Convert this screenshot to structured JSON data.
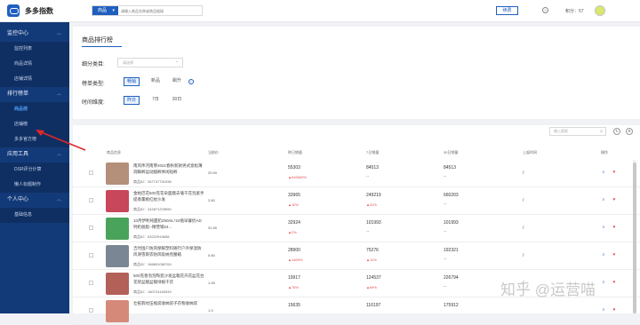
{
  "app": {
    "brand": "多多指数"
  },
  "search": {
    "select_label": "商品",
    "placeholder": "请输入商品名称或商品链接"
  },
  "topbar": {
    "upgrade_label": "续费",
    "help_icon": "?",
    "points": "积分：57"
  },
  "sidebar": {
    "sections": [
      {
        "label": "监控中心",
        "items": [
          "监控列表",
          "商品详情",
          "店铺详情"
        ]
      },
      {
        "label": "排行榜单",
        "items": [
          "商品榜",
          "店铺榜",
          "多多官方榜"
        ],
        "active": "商品榜"
      },
      {
        "label": "应用工具",
        "items": [
          "DSR评分计算",
          "懒人标题制作"
        ]
      },
      {
        "label": "个人中心",
        "items": [
          "基础信息"
        ]
      }
    ]
  },
  "page": {
    "tab_title": "商品排行榜",
    "filters": {
      "category_label": "细分类目:",
      "category_placeholder": "请选择",
      "type_label": "榜单类型:",
      "type_options": [
        "畅销",
        "新品",
        "飙升"
      ],
      "type_selected": "畅销",
      "time_label": "时间维度:",
      "time_options": [
        "昨日",
        "7日",
        "30日"
      ],
      "time_selected": "昨日"
    },
    "table_search_placeholder": "输入搜索",
    "columns": [
      "商品信息",
      "当前价",
      "昨日销量",
      "7日销量",
      "30日销量",
      "上架时间",
      "操作"
    ]
  },
  "table": {
    "rows": [
      {
        "name": "南风伟河南芽2021春秋新款男式宽松薄洞脚裤运动腿裤休闲短裤",
        "id": "商品ID：267747751936",
        "price": "29.90",
        "yesterday": "55303",
        "yesterday_change": "▲616600%",
        "week": "84513",
        "week_change": "--",
        "month": "84513",
        "month_change": "--",
        "shelf": "/",
        "thumb_color": "#b48f7a"
      },
      {
        "name": "金帕巴花500克花朵面膜去皱干花泡紧手提香薰桃红枕沙发",
        "id": "商品ID：242871378950",
        "price": "2.60",
        "yesterday": "33965",
        "yesterday_change": "▲10%",
        "week": "249219",
        "week_change": "▲31%",
        "month": "660203",
        "month_change": "--",
        "shelf": "/",
        "thumb_color": "#c8475a"
      },
      {
        "name": "10月伊利纯甜奶250mL*24瓶早餐奶AD钙奶脱脂--精营销24...",
        "id": "商品ID：53222919658",
        "price": "31.90",
        "yesterday": "32924",
        "yesterday_change": "▲2%",
        "week": "101993",
        "week_change": "--",
        "month": "101993",
        "month_change": "--",
        "shelf": "/",
        "thumb_color": "#4aa35a"
      },
      {
        "name": "吉时囤户防风保暖塑料随行户外保温防风滑雪雨衣防风吸纳兜腰箱",
        "id": "商品ID：166891080764",
        "price": "0.60",
        "yesterday": "28900",
        "yesterday_change": "▲1469%",
        "week": "75276",
        "week_change": "▲11%",
        "month": "192321",
        "month_change": "--",
        "shelf": "/",
        "thumb_color": "#7b8694"
      },
      {
        "name": "500克香泡泡陶瓷沙发盆栽花卉花盆花台花架盆栽盆栽绿植干货",
        "id": "商品ID：180724163934",
        "price": "1.99",
        "yesterday": "19917",
        "yesterday_change": "▲75%",
        "week": "124537",
        "week_change": "▲69%",
        "month": "226794",
        "month_change": "--",
        "shelf": "/",
        "thumb_color": "#b26058"
      },
      {
        "name": "壮拓翡纹压缩袋收纳袋子衣物收纳袋",
        "id": "",
        "price": "1.3",
        "yesterday": "15635",
        "yesterday_change": "",
        "week": "116197",
        "week_change": "",
        "month": "175912",
        "month_change": "",
        "shelf": "/",
        "thumb_color": "#d58a79"
      }
    ]
  },
  "watermark": "知乎 @运营喵"
}
